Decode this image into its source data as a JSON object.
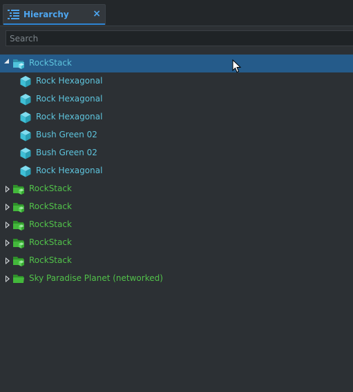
{
  "tab": {
    "title": "Hierarchy",
    "close_glyph": "×",
    "icon": "hierarchy-list-icon"
  },
  "search": {
    "placeholder": "Search",
    "value": ""
  },
  "colors": {
    "background": "#2c3034",
    "selection": "#255b8a",
    "tab_accent": "#4ea6f0",
    "prefab_text": "#5ec4dd",
    "group_text": "#52c24a",
    "prefab_icon": "#3fbfd6",
    "group_icon": "#43b83b"
  },
  "tree": {
    "root": {
      "label": "RockStack",
      "icon": "prefab-folder-icon",
      "expanded": true,
      "selected": true,
      "children": [
        {
          "label": "Rock Hexagonal",
          "icon": "cube-icon"
        },
        {
          "label": "Rock Hexagonal",
          "icon": "cube-icon"
        },
        {
          "label": "Rock Hexagonal",
          "icon": "cube-icon"
        },
        {
          "label": "Bush Green 02",
          "icon": "cube-icon"
        },
        {
          "label": "Bush Green 02",
          "icon": "cube-icon"
        },
        {
          "label": "Rock Hexagonal",
          "icon": "cube-icon"
        }
      ]
    },
    "groups": [
      {
        "label": "RockStack",
        "icon": "prefab-folder-icon",
        "expanded": false
      },
      {
        "label": "RockStack",
        "icon": "prefab-folder-icon",
        "expanded": false
      },
      {
        "label": "RockStack",
        "icon": "prefab-folder-icon",
        "expanded": false
      },
      {
        "label": "RockStack",
        "icon": "prefab-folder-icon",
        "expanded": false
      },
      {
        "label": "RockStack",
        "icon": "prefab-folder-icon",
        "expanded": false
      },
      {
        "label": "Sky Paradise Planet (networked)",
        "icon": "folder-icon",
        "expanded": false
      }
    ]
  }
}
